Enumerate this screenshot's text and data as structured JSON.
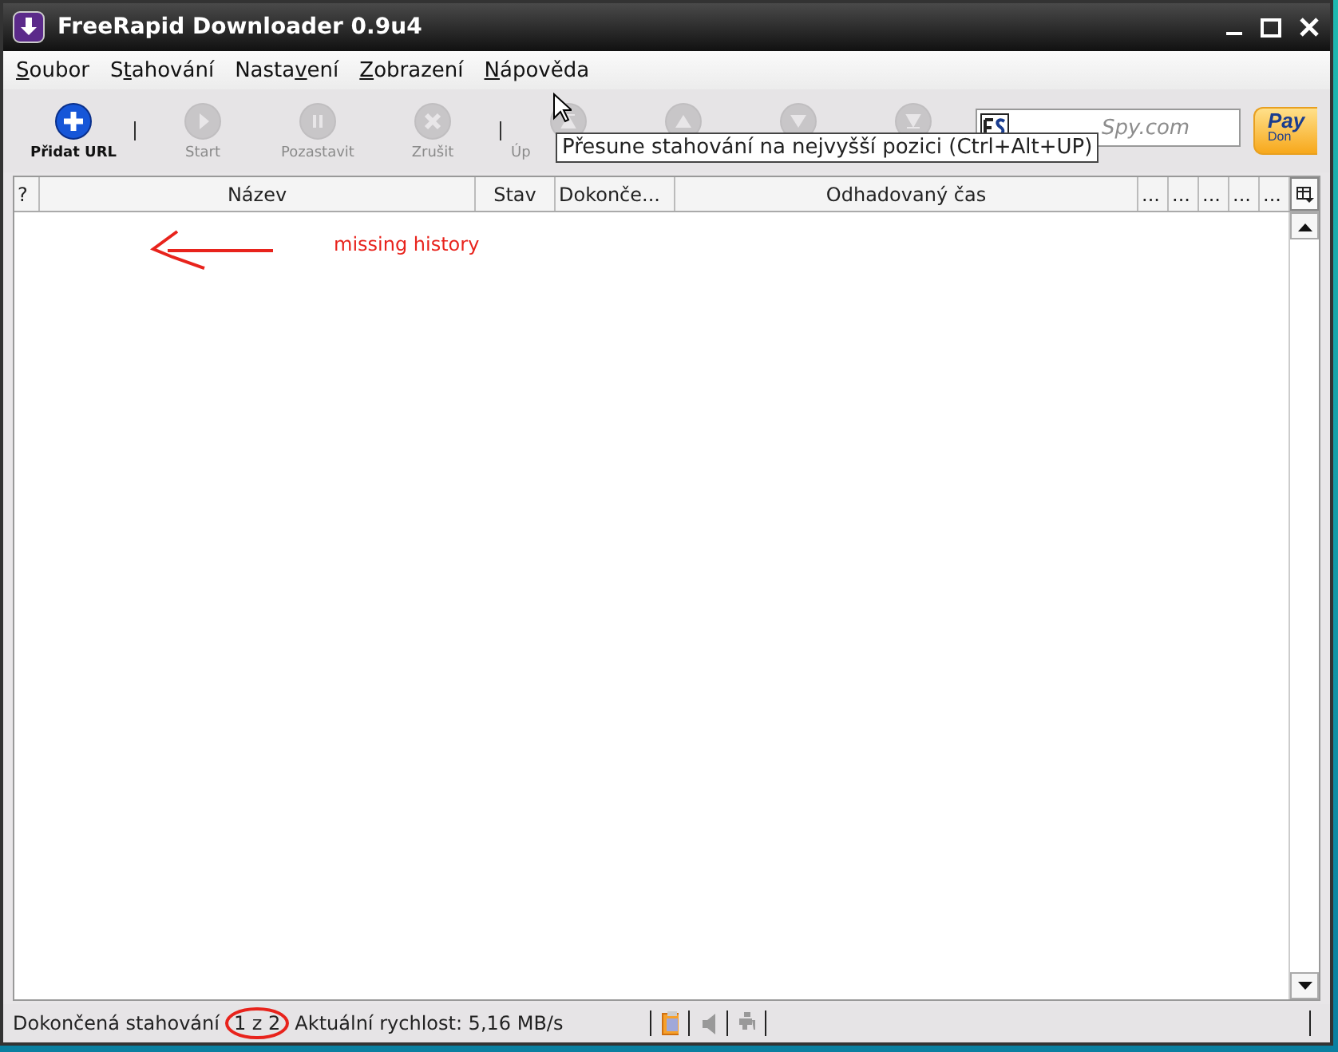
{
  "window": {
    "title": "FreeRapid Downloader 0.9u4"
  },
  "menu": [
    {
      "key": "S",
      "after": "oubor"
    },
    {
      "before": "S",
      "key": "t",
      "after": "ahování"
    },
    {
      "before": "Nasta",
      "key": "v",
      "after": "ení"
    },
    {
      "key": "Z",
      "after": "obrazení"
    },
    {
      "key": "N",
      "after": "ápověda"
    }
  ],
  "toolbar": {
    "buttons": [
      {
        "kind": "add",
        "label": "Přidat URL",
        "disabled": false
      },
      {
        "kind": "play",
        "label": "Start",
        "disabled": true
      },
      {
        "kind": "pause",
        "label": "Pozastavit",
        "disabled": true
      },
      {
        "kind": "cancel",
        "label": "Zrušit",
        "disabled": true
      },
      {
        "kind": "top",
        "label": "Úp",
        "disabled": true
      },
      {
        "kind": "up",
        "disabled": true
      },
      {
        "kind": "down",
        "disabled": true
      },
      {
        "kind": "bottom",
        "disabled": true
      }
    ],
    "search": {
      "placeholder": "Spy.com"
    },
    "donate": {
      "line1": "Pay",
      "line2": "Don"
    }
  },
  "tooltip": "Přesune stahování na nejvyšší pozici (Ctrl+Alt+UP)",
  "table": {
    "columns": [
      "?",
      "Název",
      "Stav",
      "Dokonče...",
      "Odhadovaný čas",
      "...",
      "...",
      "...",
      "...",
      "..."
    ]
  },
  "annotation": {
    "text": "missing history"
  },
  "status_bar": {
    "label": "Dokončená stahování",
    "count": "1 z 2",
    "speed": "Aktuální rychlost: 5,16 MB/s"
  }
}
